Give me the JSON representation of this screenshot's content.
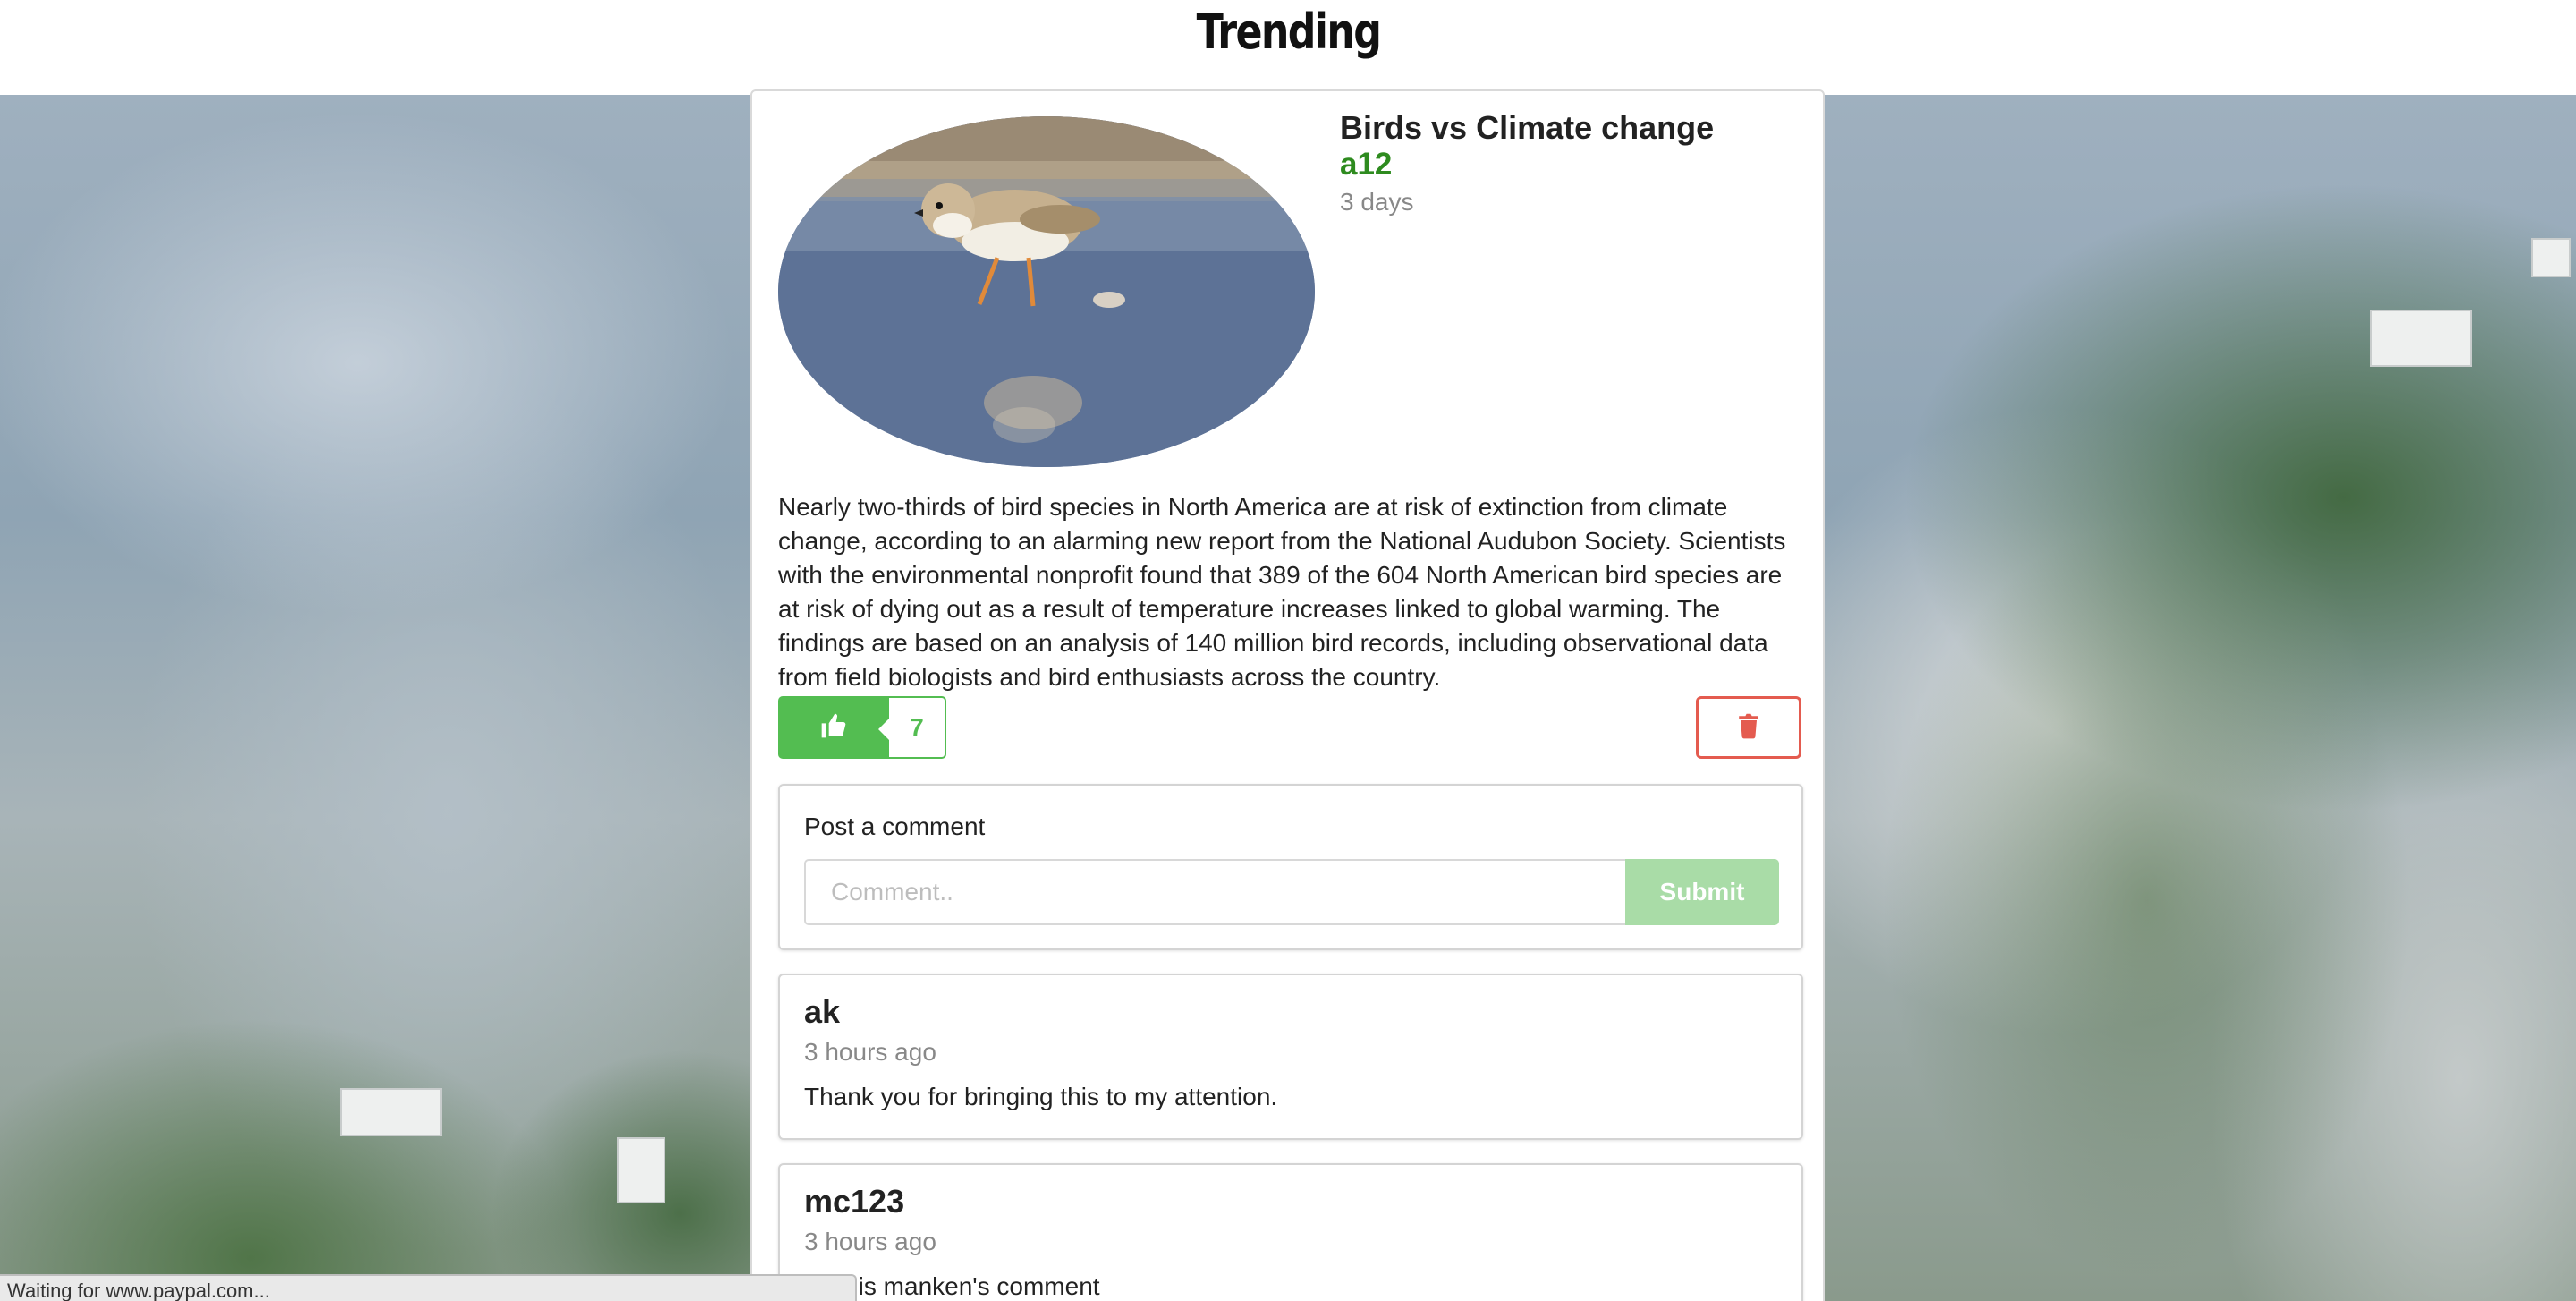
{
  "header": {
    "title": "Trending"
  },
  "post": {
    "title": "Birds vs Climate change",
    "author": "a12",
    "time": "3 days",
    "body": "Nearly two-thirds of bird species in North America are at risk of extinction from climate change, according to an alarming new report from the National Audubon Society. Scientists with the environmental nonprofit found that 389 of the 604 North American bird species are at risk of dying out as a result of temperature increases linked to global warming. The findings are based on an analysis of 140 million bird records, including observational data from field biologists and bird enthusiasts across the country.",
    "like_icon": "thumbs-up-icon",
    "like_count": "7",
    "delete_icon": "trash-icon"
  },
  "comment_form": {
    "label": "Post a comment",
    "placeholder": "Comment..",
    "value": "",
    "submit_label": "Submit"
  },
  "comments": [
    {
      "author": "ak",
      "time": "3 hours ago",
      "text": "Thank you for bringing this to my attention."
    },
    {
      "author": "mc123",
      "time": "3 hours ago",
      "text": "This is manken's comment"
    }
  ],
  "status_bar": {
    "text": "Waiting for www.paypal.com..."
  },
  "colors": {
    "accent_green": "#53bd51",
    "author_green": "#2e8b1f",
    "danger_red": "#e45b4f",
    "submit_disabled": "#a9dca7"
  }
}
